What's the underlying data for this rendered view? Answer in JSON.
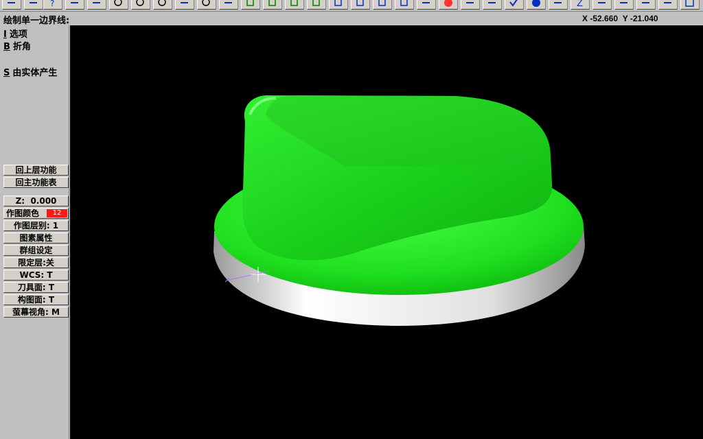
{
  "toolbar": {
    "icons": [
      "back-icon",
      "forward-icon",
      "help-icon",
      "save-icon",
      "select-icon",
      "zoom-icon",
      "zoom-out-icon",
      "zoom-fit-icon",
      "pan-icon",
      "zoom-window-icon",
      "rotate-icon",
      "view-top-icon",
      "view-front-icon",
      "view-side-icon",
      "view-iso-icon",
      "view-cube-1-icon",
      "view-cube-2-icon",
      "view-cube-3-icon",
      "view-cube-4-icon",
      "pencil-icon",
      "no-entry-icon",
      "transform-icon",
      "transform-2-icon",
      "checkmark-icon",
      "sphere-icon",
      "layer-icon",
      "z-icon",
      "line-icon",
      "point-icon",
      "arc-icon",
      "curve-icon",
      "rectangle-icon"
    ]
  },
  "prompt": "绘制单一边界线:",
  "coords": {
    "x_label": "X",
    "x_value": "-52.660",
    "y_label": "Y",
    "y_value": "-21.040"
  },
  "menu": {
    "items": [
      {
        "key": "I",
        "label": "选项"
      },
      {
        "key": "B",
        "label": "折角"
      },
      {
        "key": "S",
        "label": "由实体产生"
      }
    ]
  },
  "status": {
    "back_label": "回上层功能",
    "main_label": "回主功能表",
    "z_label": "Z:",
    "z_value": "0.000",
    "color_label": "作图颜色",
    "color_value": "12",
    "color_hex": "#ff1a1a",
    "level_label": "作图层别: 1",
    "attributes_label": "图素属性",
    "group_label": "群组设定",
    "limit_label": "限定层:关",
    "wcs_label": "WCS:  T",
    "tool_plane_label": "刀具面: T",
    "construction_plane_label": "构图面: T",
    "screen_view_label": "萤幕视角: M"
  },
  "model": {
    "body_color": "#22e022",
    "base_color": "#e8e8e8"
  }
}
